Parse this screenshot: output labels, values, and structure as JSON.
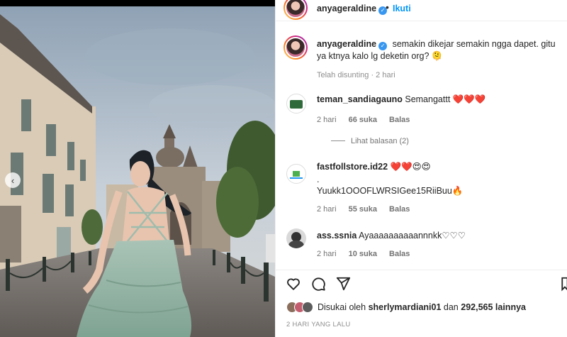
{
  "post": {
    "username": "anyageraldine",
    "follow_label": "Ikuti",
    "header_separator": "•",
    "caption": "semakin dikejar semakin ngga dapet. gitu ya ktnya kalo lg deketin org? 🫠",
    "caption_meta": "Telah disunting · 2 hari"
  },
  "comments": [
    {
      "username": "teman_sandiagauno",
      "text": "Semangattt ❤️❤️❤️",
      "time": "2 hari",
      "likes": "66 suka",
      "reply": "Balas",
      "view_replies": "Lihat balasan (2)"
    },
    {
      "username": "fastfollstore.id22",
      "text": "❤️❤️😍😍",
      "text2": ".",
      "text3": "Yuukk1OOOFLWRSIGee15RiiBuu🔥",
      "time": "2 hari",
      "likes": "55 suka",
      "reply": "Balas"
    },
    {
      "username": "ass.ssnia",
      "text": "Ayaaaaaaaaaannnkk♡♡♡",
      "time": "2 hari",
      "likes": "10 suka",
      "reply": "Balas"
    }
  ],
  "footer": {
    "liked_prefix": "Disukai oleh",
    "liked_user": "sherlymardiani01",
    "liked_mid": "dan",
    "liked_count": "292,565 lainnya",
    "timestamp": "2 HARI YANG LALU"
  },
  "icons": {
    "like": "heart-icon",
    "comment": "comment-icon",
    "share": "share-icon",
    "verified": "verified-badge-icon",
    "prev": "chevron-left-icon"
  },
  "colors": {
    "accent": "#0095f6",
    "verified": "#3897f0",
    "muted": "#737373"
  }
}
